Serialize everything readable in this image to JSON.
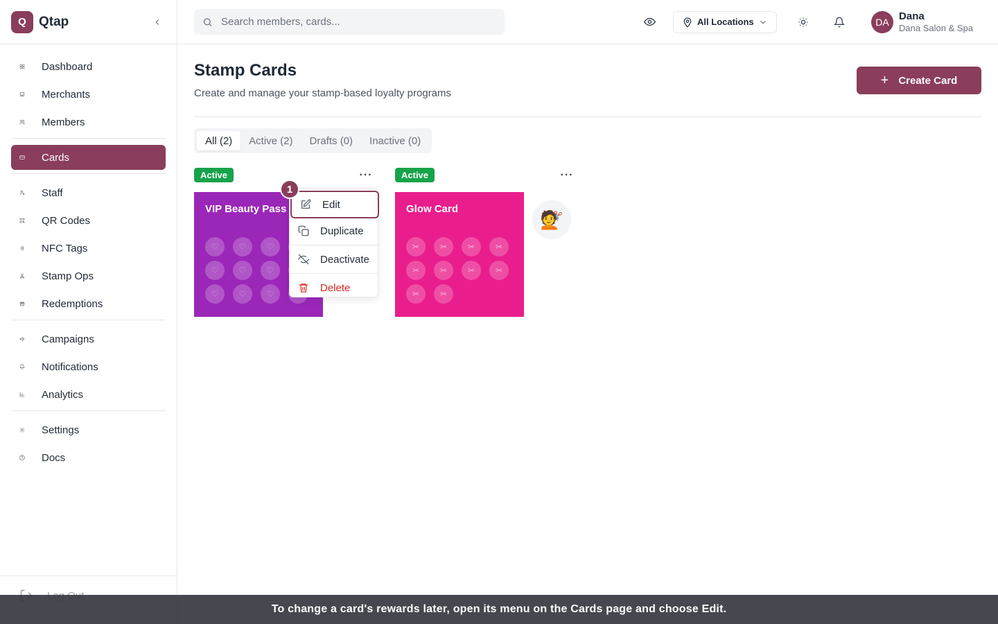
{
  "brand": {
    "logo_letter": "Q",
    "name": "Qtap"
  },
  "sidebar": {
    "groups": [
      [
        {
          "label": "Dashboard",
          "icon": "dashboard-icon"
        },
        {
          "label": "Merchants",
          "icon": "store-icon"
        },
        {
          "label": "Members",
          "icon": "users-icon"
        }
      ],
      [
        {
          "label": "Cards",
          "icon": "card-icon",
          "active": true
        }
      ],
      [
        {
          "label": "Staff",
          "icon": "staff-icon"
        },
        {
          "label": "QR Codes",
          "icon": "qr-icon"
        },
        {
          "label": "NFC Tags",
          "icon": "nfc-icon"
        },
        {
          "label": "Stamp Ops",
          "icon": "stamp-icon"
        },
        {
          "label": "Redemptions",
          "icon": "gift-icon"
        }
      ],
      [
        {
          "label": "Campaigns",
          "icon": "megaphone-icon"
        },
        {
          "label": "Notifications",
          "icon": "bell-icon"
        },
        {
          "label": "Analytics",
          "icon": "chart-icon"
        }
      ],
      [
        {
          "label": "Settings",
          "icon": "gear-icon"
        },
        {
          "label": "Docs",
          "icon": "help-icon"
        }
      ]
    ],
    "logout_label": "Log Out"
  },
  "header": {
    "search_placeholder": "Search members, cards...",
    "location_label": "All Locations",
    "user": {
      "initials": "DA",
      "name": "Dana",
      "business": "Dana Salon & Spa"
    }
  },
  "main": {
    "title": "Stamp Cards",
    "subtitle": "Create and manage your stamp-based loyalty programs",
    "create_label": "Create Card",
    "tabs": [
      {
        "label": "All (2)",
        "active": true
      },
      {
        "label": "Active (2)"
      },
      {
        "label": "Drafts (0)"
      },
      {
        "label": "Inactive (0)"
      }
    ],
    "cards": [
      {
        "name": "VIP Beauty Pass",
        "status": "Active",
        "color": "#9b27b8",
        "stamp_glyph": "♡",
        "stamps": 12,
        "emoji": ""
      },
      {
        "name": "Glow Card",
        "status": "Active",
        "color": "#e91e8c",
        "stamp_glyph": "✂",
        "stamps": 10,
        "emoji": "💇"
      }
    ]
  },
  "dropdown": {
    "step_number": "1",
    "items": [
      {
        "label": "Edit",
        "icon": "edit-icon"
      },
      {
        "label": "Duplicate",
        "icon": "copy-icon"
      },
      {
        "label": "Deactivate",
        "icon": "eye-off-icon"
      },
      {
        "label": "Delete",
        "icon": "trash-icon",
        "danger": true
      }
    ]
  },
  "hint": "To change a card's rewards later, open its menu on the Cards page and choose Edit.",
  "colors": {
    "brand": "#8a3d5c",
    "active_badge": "#16a34a",
    "danger": "#dc2626"
  }
}
